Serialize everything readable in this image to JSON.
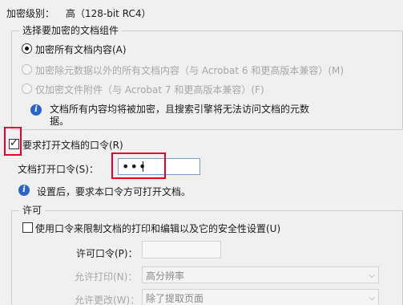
{
  "encryption": {
    "level_label": "加密级别：",
    "level_value": "高（128-bit RC4）"
  },
  "components": {
    "legend": "选择要加密的文档组件",
    "options": [
      {
        "label": "加密所有文档内容(A)",
        "selected": true,
        "enabled": true
      },
      {
        "label": "加密除元数据以外的所有文档内容（与 Acrobat 6 和更高版本兼容）(M)",
        "selected": false,
        "enabled": false
      },
      {
        "label": "仅加密文件附件（与 Acrobat 7 和更高版本兼容）(F)",
        "selected": false,
        "enabled": false
      }
    ],
    "info_line1": "文档所有内容均将被加密，且搜索引擎将无法访问文档的元数",
    "info_line2": "据。"
  },
  "open_password": {
    "checkbox_label": "要求打开文档的口令(R)",
    "checked": true,
    "field_label": "文档打开口令(S)：",
    "field_value": "•••",
    "info_text": "设置后，要求本口令方可打开文档。"
  },
  "permissions": {
    "legend": "许可",
    "checkbox_label": "使用口令来限制文档的打印和编辑以及它的安全性设置(U)",
    "checked": false,
    "permission_password_label": "许可口令(P)：",
    "print_label": "允许打印(N)：",
    "print_value": "高分辨率",
    "changes_label": "允许更改(W)：",
    "changes_value": "除了提取页面"
  },
  "icons": {
    "info": "i",
    "checkmark": "✓",
    "dropdown_arrow": "⌵"
  },
  "colors": {
    "highlight_red": "#e4002b",
    "info_blue": "#2b63c7"
  }
}
